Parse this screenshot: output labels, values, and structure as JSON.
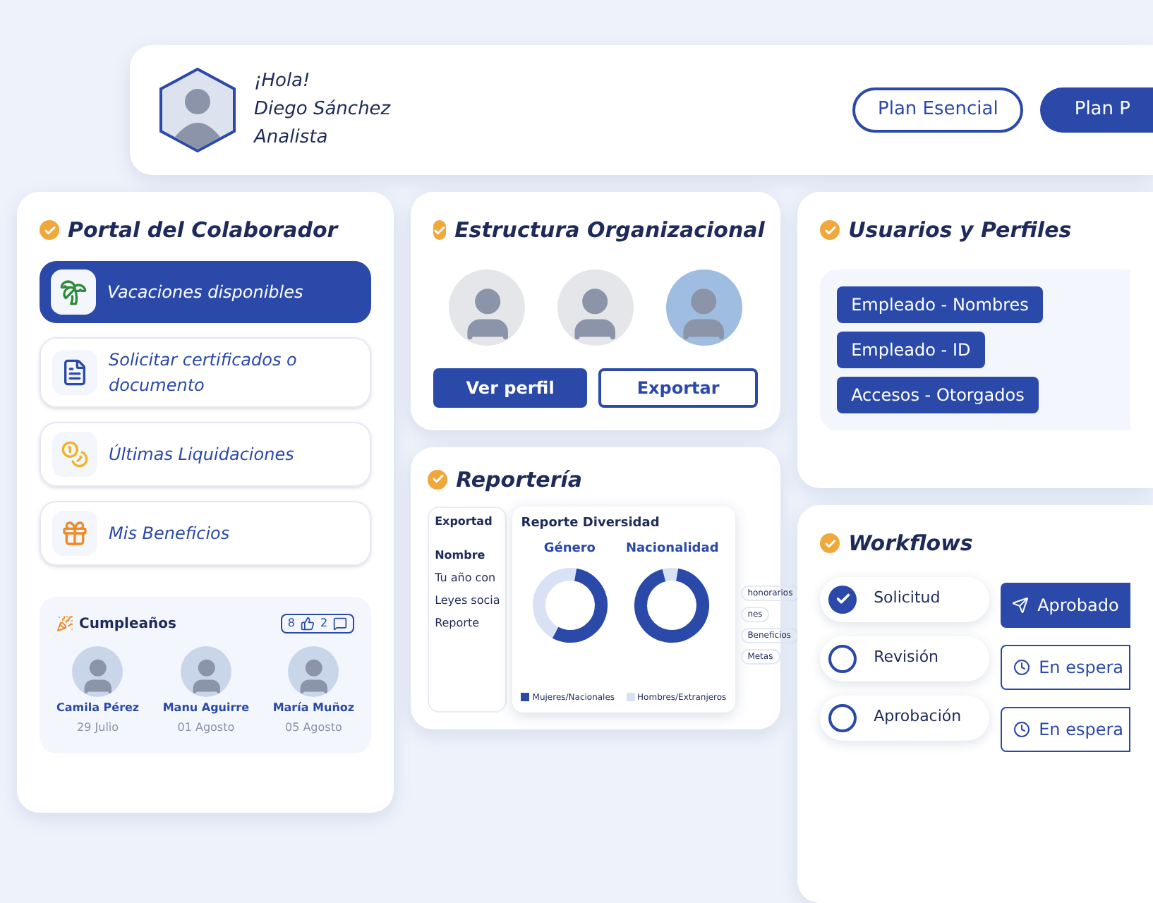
{
  "header": {
    "greeting": "¡Hola!",
    "name": "Diego Sánchez",
    "role": "Analista",
    "plans": [
      {
        "label": "Plan Esencial",
        "selected": false
      },
      {
        "label": "Plan P",
        "selected": true
      }
    ]
  },
  "portal": {
    "title": "Portal del Colaborador",
    "items": [
      {
        "label": "Vacaciones disponibles",
        "kind": "palm",
        "selected": true
      },
      {
        "label": "Solicitar certificados o documento",
        "kind": "document",
        "selected": false
      },
      {
        "label": "Últimas Liquidaciones",
        "kind": "coins",
        "selected": false
      },
      {
        "label": "Mis Beneficios",
        "kind": "gift",
        "selected": false
      }
    ],
    "birthdays": {
      "title": "Cumpleaños",
      "likes": "8",
      "comments": "2",
      "people": [
        {
          "name": "Camila Pérez",
          "date": "29 Julio"
        },
        {
          "name": "Manu Aguirre",
          "date": "01 Agosto"
        },
        {
          "name": "María Muñoz",
          "date": "05 Agosto"
        }
      ]
    }
  },
  "structure": {
    "title": "Estructura Organizacional",
    "buttons": [
      {
        "label": "Ver perfil",
        "kind": "primary"
      },
      {
        "label": "Exportar",
        "kind": "outline"
      }
    ]
  },
  "users": {
    "title": "Usuarios y Perfiles",
    "tags": [
      "Empleado - Nombres",
      "Empleado - ID",
      "Accesos - Otorgados"
    ]
  },
  "reports": {
    "title": "Reportería",
    "back_panel": {
      "title": "Exportad",
      "column": "Nombre",
      "rows": [
        "Tu año con",
        "Leyes socia",
        "Reporte"
      ]
    },
    "chips": [
      "honorarios",
      "nes",
      "Beneficios",
      "Metas"
    ],
    "diversity": {
      "title": "Reporte Diversidad",
      "charts": [
        "Género",
        "Nacionalidad"
      ],
      "legend": [
        "Mujeres/Nacionales",
        "Hombres/Extranjeros"
      ]
    }
  },
  "workflows": {
    "title": "Workflows",
    "steps": [
      {
        "label": "Solicitud",
        "checked": true
      },
      {
        "label": "Revisión",
        "checked": false
      },
      {
        "label": "Aprobación",
        "checked": false
      }
    ],
    "statuses": [
      {
        "label": "Aprobado",
        "kind": "approved"
      },
      {
        "label": "En espera",
        "kind": "waiting"
      },
      {
        "label": "En espera",
        "kind": "waiting"
      }
    ]
  }
}
